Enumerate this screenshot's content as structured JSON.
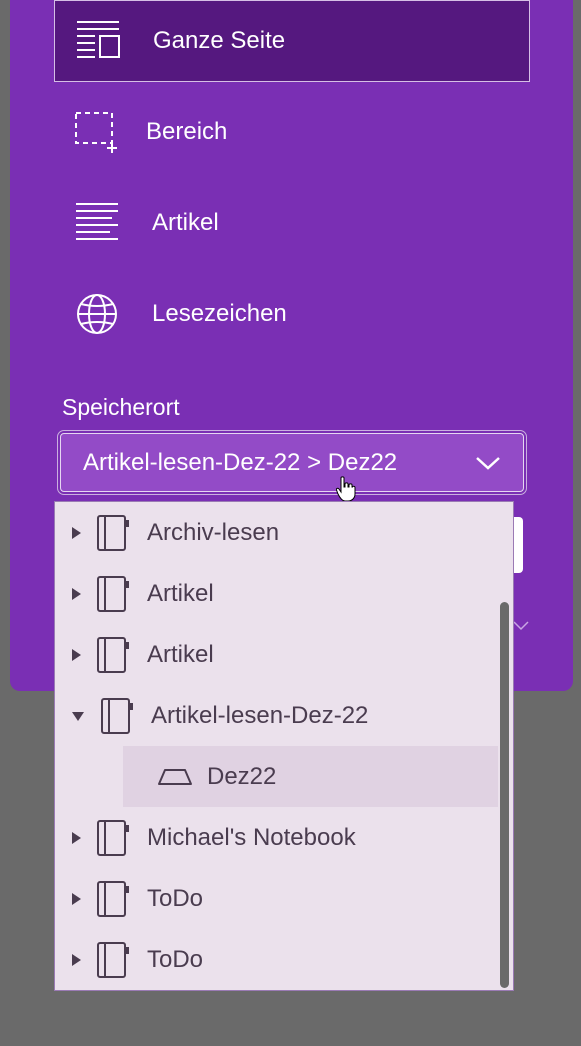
{
  "capture_options": [
    {
      "label": "Ganze Seite",
      "icon": "full-page-icon",
      "selected": true
    },
    {
      "label": "Bereich",
      "icon": "region-select-icon",
      "selected": false
    },
    {
      "label": "Artikel",
      "icon": "article-icon",
      "selected": false
    },
    {
      "label": "Lesezeichen",
      "icon": "globe-icon",
      "selected": false
    }
  ],
  "location": {
    "label": "Speicherort",
    "value": "Artikel-lesen-Dez-22 > Dez22"
  },
  "dropdown": {
    "items": [
      {
        "type": "notebook",
        "label": "Archiv-lesen",
        "expanded": false
      },
      {
        "type": "notebook",
        "label": "Artikel",
        "expanded": false
      },
      {
        "type": "notebook",
        "label": "Artikel",
        "expanded": false
      },
      {
        "type": "notebook",
        "label": "Artikel-lesen-Dez-22",
        "expanded": true
      },
      {
        "type": "section",
        "label": "Dez22",
        "selected": true
      },
      {
        "type": "notebook",
        "label": "Michael's Notebook",
        "expanded": false
      },
      {
        "type": "notebook",
        "label": "ToDo",
        "expanded": false
      },
      {
        "type": "notebook",
        "label": "ToDo",
        "expanded": false
      }
    ]
  },
  "colors": {
    "panel": "#7a2fb4",
    "selected_option": "#55187f",
    "dropdown_bg": "#ebe1ec",
    "selected_row": "#e0d2e2"
  }
}
